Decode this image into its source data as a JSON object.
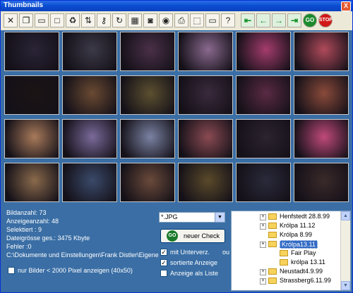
{
  "window": {
    "title": "Thumbnails",
    "close_label": "X"
  },
  "toolbar": {
    "buttons": [
      {
        "name": "cut-icon",
        "glyph": "✕"
      },
      {
        "name": "copy-icon",
        "glyph": "❐"
      },
      {
        "name": "open-folder-icon",
        "glyph": "▭"
      },
      {
        "name": "window-icon",
        "glyph": "□"
      },
      {
        "name": "recycle-bin-icon",
        "glyph": "♻"
      },
      {
        "name": "rename-icon",
        "glyph": "⇅"
      },
      {
        "name": "key-icon",
        "glyph": "⚷"
      },
      {
        "name": "rotate-icon",
        "glyph": "↻"
      },
      {
        "name": "calendar-icon",
        "glyph": "▦"
      },
      {
        "name": "camera-icon",
        "glyph": "◙"
      },
      {
        "name": "color-wheel-icon",
        "glyph": "◉"
      },
      {
        "name": "print-icon",
        "glyph": "⎙"
      },
      {
        "name": "crop-icon",
        "glyph": "⬚"
      },
      {
        "name": "resize-icon",
        "glyph": "▭"
      },
      {
        "name": "help-icon",
        "glyph": "?"
      }
    ],
    "nav": [
      {
        "name": "first-arrow-icon",
        "glyph": "⇤"
      },
      {
        "name": "back-arrow-icon",
        "glyph": "←"
      },
      {
        "name": "forward-arrow-icon",
        "glyph": "→"
      },
      {
        "name": "last-arrow-icon",
        "glyph": "⇥"
      }
    ],
    "go_label": "GO",
    "stop_label": "STOP"
  },
  "thumbnails": [
    [
      "#2a2436",
      "#3c3a48",
      "#4a3048",
      "#8a6a8e",
      "#a43c6c",
      "#b04a5a"
    ],
    [
      "#1a1414",
      "#6a4a32",
      "#5c5030",
      "#3a2a3c",
      "#5a2a44",
      "#8a4a3a"
    ],
    [
      "#a87a5a",
      "#7a6a9a",
      "#7a82a2",
      "#8a4a52",
      "#2c2430",
      "#c04a7a"
    ],
    [
      "#8a6a4c",
      "#3a4a6a",
      "#6a4a3a",
      "#5a4a2a",
      "#2a2a3a",
      "#3a2a2a"
    ]
  ],
  "stats": {
    "bildanzahl": "Bildanzahl: 73",
    "anzeigeanzahl": "Anzeigeanzahl: 48",
    "selektiert": "Selektiert : 9",
    "dateigroesse": "Dateigrösse ges.: 3475 Kbyte",
    "fehler": "Fehler :0",
    "path": "C:\\Dokumente und Einstellungen\\Frank Distler\\Eigene"
  },
  "filter": {
    "checkbox_label": "nur Bilder < 2000 Pixel anzeigen (40x50)",
    "checked": false
  },
  "filetype_select": {
    "value": "*.JPG"
  },
  "check_button": {
    "icon_label": "GO",
    "label": "neuer Check"
  },
  "options": [
    {
      "label": "mit Unterverz.",
      "checked": true
    },
    {
      "label": "sortierte Anzeige",
      "checked": true
    },
    {
      "label": "Anzeige als Liste",
      "checked": false
    }
  ],
  "stray_label": "ou",
  "tree": {
    "nodes": [
      {
        "label": "Henfstedt 28.8.99",
        "level": 0,
        "plus": true,
        "selected": false
      },
      {
        "label": "Królpa 11.12",
        "level": 0,
        "plus": true,
        "selected": false
      },
      {
        "label": "Królpa 8.99",
        "level": 0,
        "plus": false,
        "selected": false
      },
      {
        "label": "Królpa13.11",
        "level": 0,
        "plus": true,
        "selected": true
      },
      {
        "label": "Fair Play",
        "level": 1,
        "plus": false,
        "selected": false
      },
      {
        "label": "królpa 13.11",
        "level": 1,
        "plus": false,
        "selected": false
      },
      {
        "label": "Neustadt4.9.99",
        "level": 0,
        "plus": true,
        "selected": false
      },
      {
        "label": "Strassberg6.11.99",
        "level": 0,
        "plus": true,
        "selected": false
      }
    ]
  },
  "scrollbar": {
    "up_glyph": "▲",
    "down_glyph": "▼"
  }
}
